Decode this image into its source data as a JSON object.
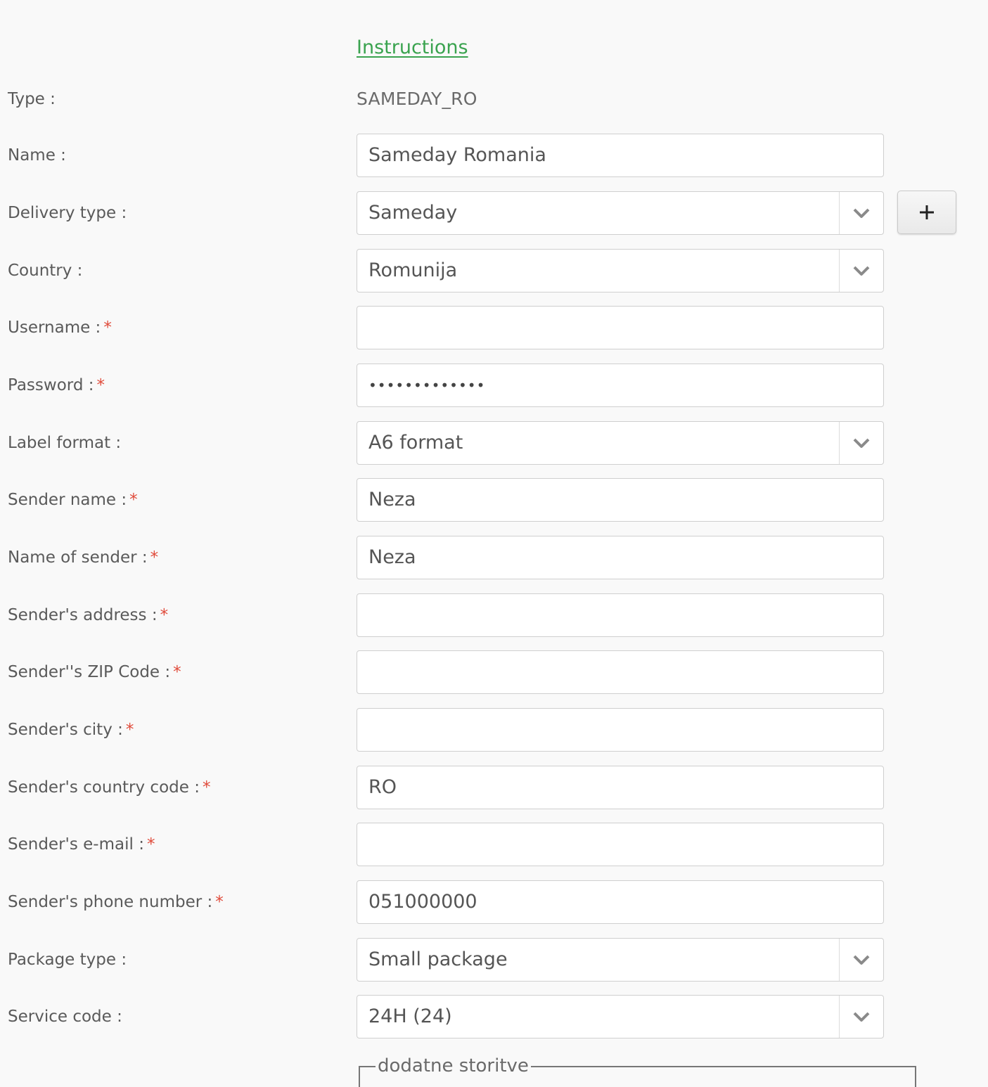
{
  "instructions_link": "Instructions",
  "fields": {
    "type": {
      "label": "Type :",
      "value": "SAMEDAY_RO"
    },
    "name": {
      "label": "Name :",
      "value": "Sameday Romania"
    },
    "delivery_type": {
      "label": "Delivery type :",
      "value": "Sameday",
      "add_button": "+"
    },
    "country": {
      "label": "Country :",
      "value": "Romunija"
    },
    "username": {
      "label": "Username :",
      "required": "*",
      "value": ""
    },
    "password": {
      "label": "Password :",
      "required": "*",
      "value": "•••••••••••••"
    },
    "label_format": {
      "label": "Label format :",
      "value": "A6 format"
    },
    "sender_name": {
      "label": "Sender name :",
      "required": "*",
      "value": "Neza"
    },
    "name_of_sender": {
      "label": "Name of sender :",
      "required": "*",
      "value": "Neza"
    },
    "sender_address": {
      "label": "Sender's address :",
      "required": "*",
      "value": ""
    },
    "sender_zip": {
      "label": "Sender''s ZIP Code :",
      "required": "*",
      "value": ""
    },
    "sender_city": {
      "label": "Sender's city :",
      "required": "*",
      "value": ""
    },
    "sender_country_code": {
      "label": "Sender's country code :",
      "required": "*",
      "value": "RO"
    },
    "sender_email": {
      "label": "Sender's e-mail :",
      "required": "*",
      "value": ""
    },
    "sender_phone": {
      "label": "Sender's phone number :",
      "required": "*",
      "value": "051000000"
    },
    "package_type": {
      "label": "Package type :",
      "value": "Small package"
    },
    "service_code": {
      "label": "Service code :",
      "value": "24H (24)"
    }
  },
  "additional_services": {
    "legend": "dodatne storitve"
  },
  "icons": {
    "dropdown": "chevron-down-icon",
    "add": "plus-icon"
  },
  "colors": {
    "link": "#3aa34f",
    "required": "#e04a3a",
    "background": "#f9f9f9"
  }
}
